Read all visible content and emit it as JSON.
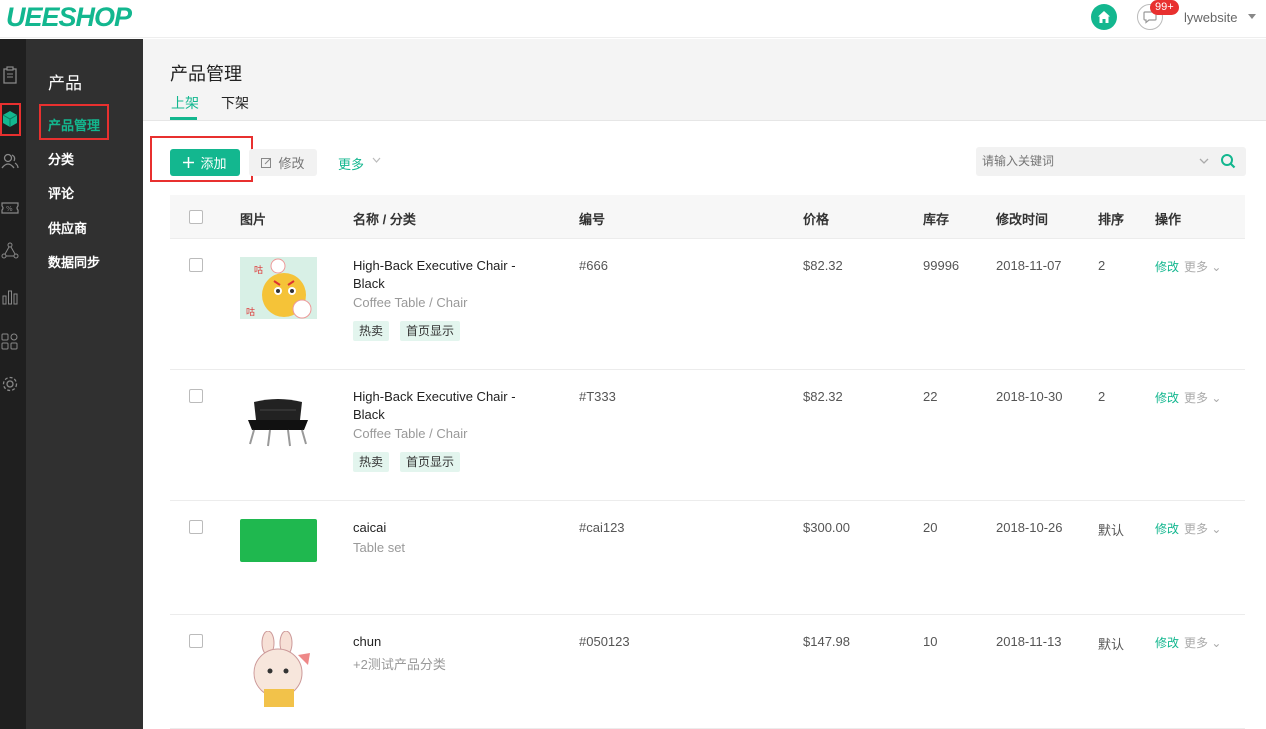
{
  "header": {
    "logo": "UEESHOP",
    "badge": "99+",
    "username": "lywebsite"
  },
  "rail": {
    "icons": [
      "clipboard-icon",
      "cube-icon",
      "users-icon",
      "discount-icon",
      "network-icon",
      "bar-chart-icon",
      "apps-icon",
      "gear-icon"
    ],
    "active_icon": "cube-icon"
  },
  "submenu": {
    "title": "产品",
    "items": [
      {
        "label": "产品管理",
        "active": true
      },
      {
        "label": "分类",
        "active": false
      },
      {
        "label": "评论",
        "active": false
      },
      {
        "label": "供应商",
        "active": false
      },
      {
        "label": "数据同步",
        "active": false
      }
    ]
  },
  "page": {
    "title": "产品管理",
    "tabs": [
      {
        "label": "上架",
        "active": true
      },
      {
        "label": "下架",
        "active": false
      }
    ]
  },
  "toolbar": {
    "add_label": "添加",
    "edit_label": "修改",
    "more_label": "更多"
  },
  "search": {
    "placeholder": "请输入关键词"
  },
  "table": {
    "headers": [
      "图片",
      "名称 / 分类",
      "编号",
      "价格",
      "库存",
      "修改时间",
      "排序",
      "操作"
    ],
    "rows": [
      {
        "name": "High-Back Executive Chair - Black",
        "category": "Coffee Table / Chair",
        "tags": [
          "热卖",
          "首页显示"
        ],
        "sku": "#666",
        "price": "$82.32",
        "stock": "99996",
        "modified": "2018-11-07",
        "order": "2",
        "op_edit": "修改",
        "op_more": "更多",
        "image": "cartoon-cat-sticker"
      },
      {
        "name": "High-Back Executive Chair - Black",
        "category": "Coffee Table / Chair",
        "tags": [
          "热卖",
          "首页显示"
        ],
        "sku": "#T333",
        "price": "$82.32",
        "stock": "22",
        "modified": "2018-10-30",
        "order": "2",
        "op_edit": "修改",
        "op_more": "更多",
        "image": "black-leather-chair"
      },
      {
        "name": "caicai",
        "category": "Table set",
        "tags": [],
        "sku": "#cai123",
        "price": "$300.00",
        "stock": "20",
        "modified": "2018-10-26",
        "order": "默认",
        "op_edit": "修改",
        "op_more": "更多",
        "image": "green-block"
      },
      {
        "name": "chun",
        "category": "+2测试产品分类",
        "tags": [],
        "sku": "#050123",
        "price": "$147.98",
        "stock": "10",
        "modified": "2018-11-13",
        "order": "默认",
        "op_edit": "修改",
        "op_more": "更多",
        "image": "cartoon-rabbit-sticker"
      }
    ]
  },
  "colors": {
    "accent": "#13b78f",
    "highlight": "#e8302f",
    "rail_bg": "#1f1f1f",
    "submenu_bg": "#303030"
  }
}
